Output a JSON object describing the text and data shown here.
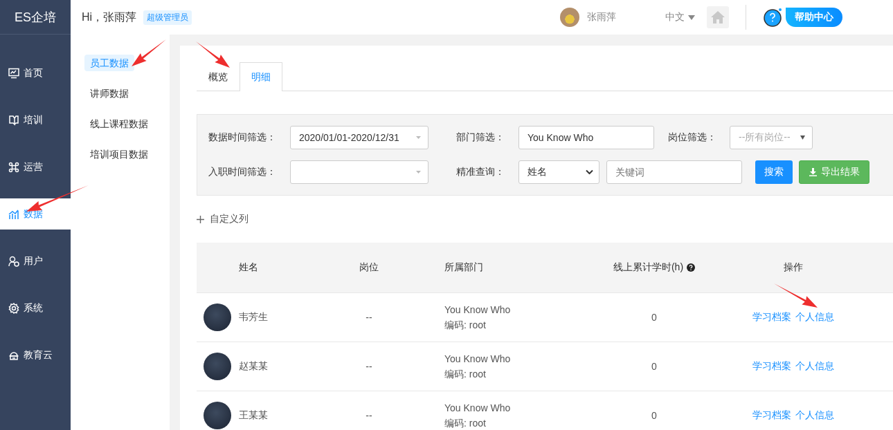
{
  "brand": {
    "logo": "ES企培"
  },
  "header": {
    "greeting": "Hi，张雨萍",
    "role_badge": "超级管理员",
    "user_name": "张雨萍",
    "language": "中文",
    "help_button": "帮助中心"
  },
  "sidebar": {
    "items": [
      {
        "label": "首页",
        "selected": false
      },
      {
        "label": "培训",
        "selected": false
      },
      {
        "label": "运营",
        "selected": false
      },
      {
        "label": "数据",
        "selected": true
      },
      {
        "label": "用户",
        "selected": false
      },
      {
        "label": "系统",
        "selected": false
      },
      {
        "label": "教育云",
        "selected": false
      }
    ]
  },
  "subnav": {
    "items": [
      {
        "label": "员工数据",
        "selected": true
      },
      {
        "label": "讲师数据",
        "selected": false
      },
      {
        "label": "线上课程数据",
        "selected": false
      },
      {
        "label": "培训项目数据",
        "selected": false
      }
    ]
  },
  "tabs": [
    {
      "label": "概览",
      "selected": false
    },
    {
      "label": "明细",
      "selected": true
    }
  ],
  "filters": {
    "rows": [
      [
        {
          "kind": "label",
          "text": "数据时间筛选："
        },
        {
          "kind": "date",
          "value": "2020/01/01-2020/12/31"
        },
        {
          "kind": "label",
          "text": "部门筛选："
        },
        {
          "kind": "input",
          "value": "You Know Who"
        },
        {
          "kind": "label",
          "text": "岗位筛选："
        },
        {
          "kind": "select",
          "placeholder": "--所有岗位--"
        }
      ],
      [
        {
          "kind": "label",
          "text": "入职时间筛选："
        },
        {
          "kind": "date"
        },
        {
          "kind": "label",
          "text": "精准查询："
        },
        {
          "kind": "select",
          "value": "姓名"
        },
        {
          "kind": "input",
          "placeholder": "关键词"
        },
        {
          "kind": "search_button",
          "text": "搜索"
        },
        {
          "kind": "export_button",
          "text": "导出结果"
        }
      ]
    ]
  },
  "customize_columns": "自定义列",
  "table": {
    "columns": [
      {
        "label": "姓名"
      },
      {
        "label": "岗位"
      },
      {
        "label": "所属部门"
      },
      {
        "label": "线上累计学时(h)",
        "help": true
      },
      {
        "label": "操作"
      }
    ],
    "rows": [
      {
        "name": "韦芳生",
        "position": "--",
        "department": "You Know Who",
        "code": "编码: root",
        "hours": "0",
        "actions": [
          "学习档案",
          "个人信息"
        ]
      },
      {
        "name": "赵某某",
        "position": "--",
        "department": "You Know Who",
        "code": "编码: root",
        "hours": "0",
        "actions": [
          "学习档案",
          "个人信息"
        ]
      },
      {
        "name": "王某某",
        "position": "--",
        "department": "You Know Who",
        "code": "编码: root",
        "hours": "0",
        "actions": [
          "学习档案",
          "个人信息"
        ]
      }
    ]
  }
}
